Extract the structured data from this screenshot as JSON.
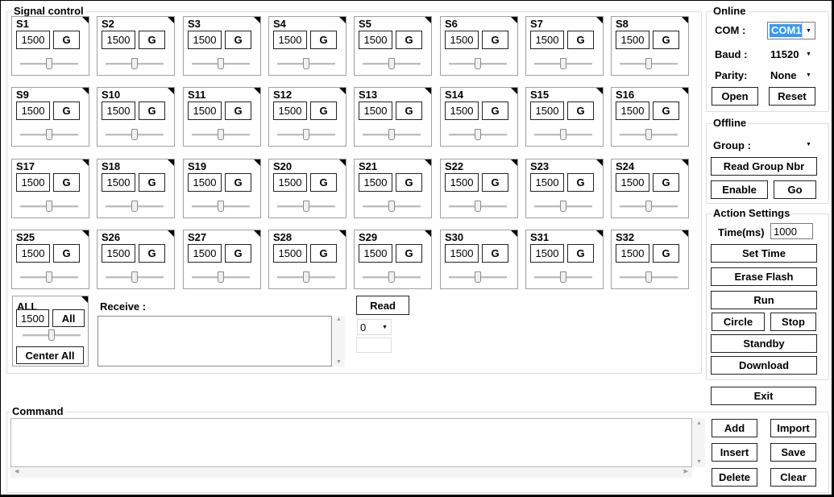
{
  "signal_control": {
    "title": "Signal control",
    "servos": [
      {
        "label": "S1",
        "value": "1500",
        "position": 0.5
      },
      {
        "label": "S2",
        "value": "1500",
        "position": 0.5
      },
      {
        "label": "S3",
        "value": "1500",
        "position": 0.5
      },
      {
        "label": "S4",
        "value": "1500",
        "position": 0.5
      },
      {
        "label": "S5",
        "value": "1500",
        "position": 0.5
      },
      {
        "label": "S6",
        "value": "1500",
        "position": 0.5
      },
      {
        "label": "S7",
        "value": "1500",
        "position": 0.5
      },
      {
        "label": "S8",
        "value": "1500",
        "position": 0.5
      },
      {
        "label": "S9",
        "value": "1500",
        "position": 0.5
      },
      {
        "label": "S10",
        "value": "1500",
        "position": 0.5
      },
      {
        "label": "S11",
        "value": "1500",
        "position": 0.5
      },
      {
        "label": "S12",
        "value": "1500",
        "position": 0.5
      },
      {
        "label": "S13",
        "value": "1500",
        "position": 0.5
      },
      {
        "label": "S14",
        "value": "1500",
        "position": 0.5
      },
      {
        "label": "S15",
        "value": "1500",
        "position": 0.5
      },
      {
        "label": "S16",
        "value": "1500",
        "position": 0.5
      },
      {
        "label": "S17",
        "value": "1500",
        "position": 0.5
      },
      {
        "label": "S18",
        "value": "1500",
        "position": 0.5
      },
      {
        "label": "S19",
        "value": "1500",
        "position": 0.5
      },
      {
        "label": "S20",
        "value": "1500",
        "position": 0.5
      },
      {
        "label": "S21",
        "value": "1500",
        "position": 0.5
      },
      {
        "label": "S22",
        "value": "1500",
        "position": 0.5
      },
      {
        "label": "S23",
        "value": "1500",
        "position": 0.5
      },
      {
        "label": "S24",
        "value": "1500",
        "position": 0.5
      },
      {
        "label": "S25",
        "value": "1500",
        "position": 0.5
      },
      {
        "label": "S26",
        "value": "1500",
        "position": 0.5
      },
      {
        "label": "S27",
        "value": "1500",
        "position": 0.5
      },
      {
        "label": "S28",
        "value": "1500",
        "position": 0.5
      },
      {
        "label": "S29",
        "value": "1500",
        "position": 0.5
      },
      {
        "label": "S30",
        "value": "1500",
        "position": 0.5
      },
      {
        "label": "S31",
        "value": "1500",
        "position": 0.5
      },
      {
        "label": "S32",
        "value": "1500",
        "position": 0.5
      }
    ],
    "go_label": "G",
    "all_box": {
      "label": "ALL",
      "value": "1500",
      "all_button": "All",
      "center_button": "Center All",
      "position": 0.5
    },
    "receive_label": "Receive :",
    "read_button": "Read",
    "read_select_value": "0",
    "read_result": ""
  },
  "online": {
    "title": "Online",
    "com_label": "COM :",
    "com_value": "COM1",
    "baud_label": "Baud :",
    "baud_value": "11520",
    "parity_label": "Parity:",
    "parity_value": "None",
    "open_button": "Open",
    "reset_button": "Reset"
  },
  "offline": {
    "title": "Offline",
    "group_label": "Group :",
    "group_value": "",
    "read_group_button": "Read Group Nbr",
    "enable_button": "Enable",
    "go_button": "Go"
  },
  "action_settings": {
    "title": "Action Settings",
    "time_label": "Time(ms)",
    "time_value": "1000",
    "set_time_button": "Set Time",
    "erase_flash_button": "Erase Flash",
    "run_button": "Run",
    "circle_button": "Circle",
    "stop_button": "Stop",
    "standby_button": "Standby",
    "download_button": "Download"
  },
  "exit_button": "Exit",
  "command": {
    "title": "Command",
    "text": "",
    "add_button": "Add",
    "import_button": "Import",
    "insert_button": "Insert",
    "save_button": "Save",
    "delete_button": "Delete",
    "clear_button": "Clear"
  },
  "icons": {
    "dropdown": "chevron-down-icon",
    "scroll_up": "scroll-up-arrow-icon",
    "scroll_down": "scroll-down-arrow-icon",
    "scroll_left": "scroll-left-arrow-icon",
    "scroll_right": "scroll-right-arrow-icon"
  },
  "colors": {
    "selection": "#3399ff",
    "border": "#dcdcdc"
  }
}
